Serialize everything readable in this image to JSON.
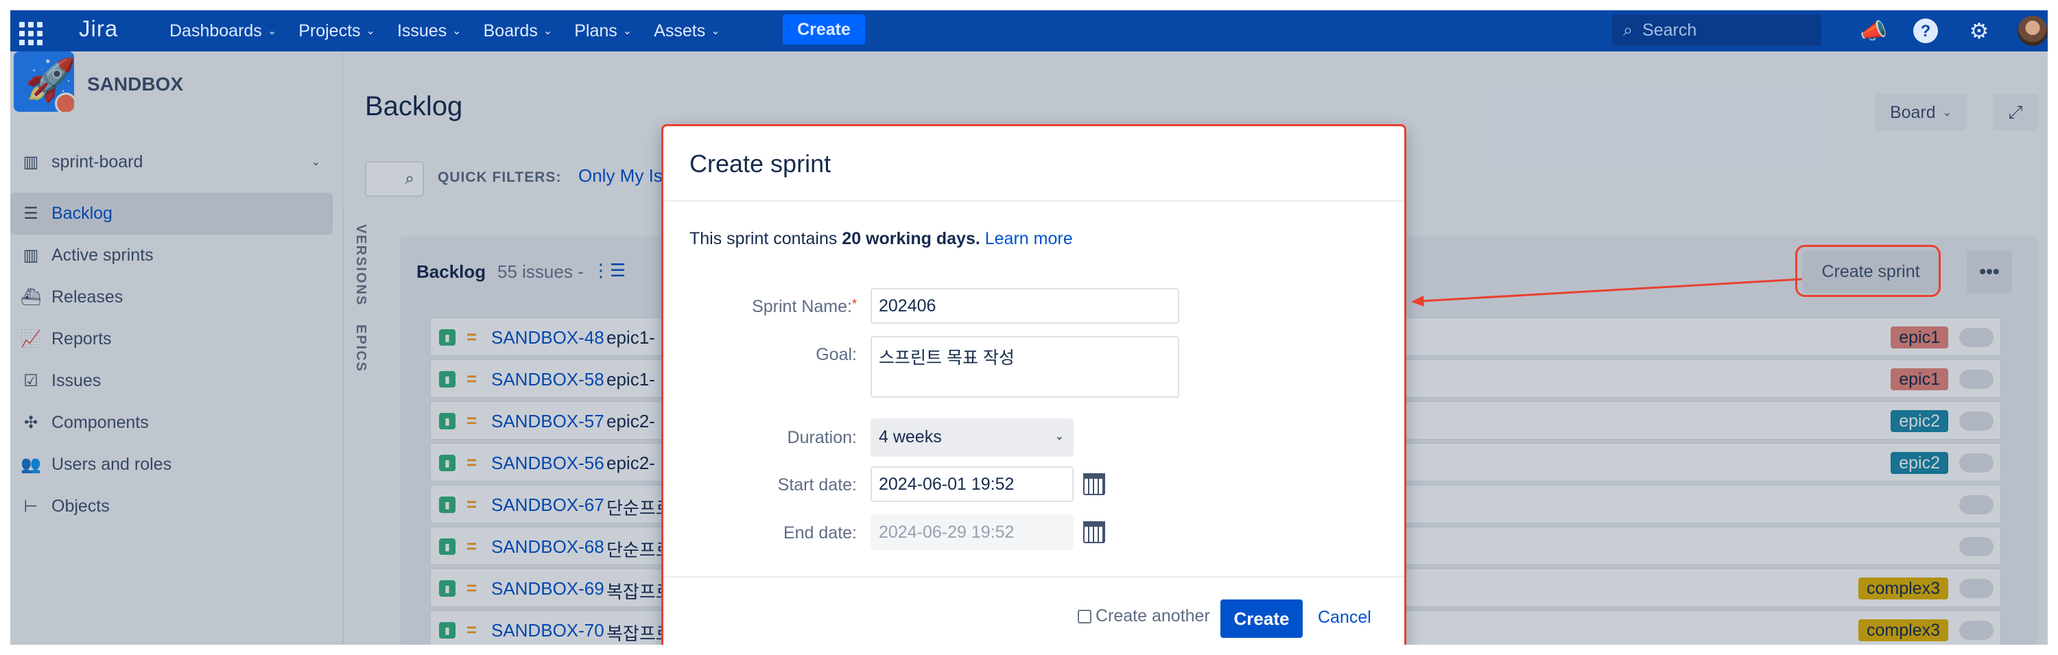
{
  "nav": {
    "logo": "Jira",
    "menus": [
      "Dashboards",
      "Projects",
      "Issues",
      "Boards",
      "Plans",
      "Assets"
    ],
    "create_label": "Create",
    "search_placeholder": "Search",
    "icons": [
      "app-switcher-icon",
      "notifications-icon",
      "help-icon",
      "settings-icon"
    ]
  },
  "sidebar": {
    "project_name": "SANDBOX",
    "board_selector": "sprint-board",
    "items": [
      {
        "label": "Backlog",
        "icon": "backlog-icon",
        "active": true
      },
      {
        "label": "Active sprints",
        "icon": "board-icon",
        "active": false
      },
      {
        "label": "Releases",
        "icon": "ship-icon",
        "active": false
      },
      {
        "label": "Reports",
        "icon": "chart-icon",
        "active": false
      },
      {
        "label": "Issues",
        "icon": "issues-icon",
        "active": false
      },
      {
        "label": "Components",
        "icon": "puzzle-icon",
        "active": false
      },
      {
        "label": "Users and roles",
        "icon": "users-icon",
        "active": false
      },
      {
        "label": "Objects",
        "icon": "hierarchy-icon",
        "active": false
      }
    ]
  },
  "main": {
    "title": "Backlog",
    "board_button": "Board",
    "quick_filters_label": "QUICK FILTERS:",
    "quick_filter_link": "Only My Is",
    "side_tabs": [
      "VERSIONS",
      "EPICS"
    ],
    "backlog": {
      "title": "Backlog",
      "count": "55 issues -",
      "create_sprint_label": "Create sprint",
      "more_label": "•••"
    },
    "issues": [
      {
        "key": "SANDBOX-48",
        "summary": "epic1-",
        "label": "epic1",
        "label_color": "#e8877a"
      },
      {
        "key": "SANDBOX-58",
        "summary": "epic1-",
        "label": "epic1",
        "label_color": "#e8877a"
      },
      {
        "key": "SANDBOX-57",
        "summary": "epic2-",
        "label": "epic2",
        "label_color": "#1d8aa8"
      },
      {
        "key": "SANDBOX-56",
        "summary": "epic2-",
        "label": "epic2",
        "label_color": "#1d8aa8"
      },
      {
        "key": "SANDBOX-67",
        "summary": "단순프로",
        "label": "",
        "label_color": ""
      },
      {
        "key": "SANDBOX-68",
        "summary": "단순프로",
        "label": "",
        "label_color": ""
      },
      {
        "key": "SANDBOX-69",
        "summary": "복잡프로",
        "label": "complex3",
        "label_color": "#e2b203"
      },
      {
        "key": "SANDBOX-70",
        "summary": "복잡프로",
        "label": "complex3",
        "label_color": "#e2b203"
      }
    ]
  },
  "modal": {
    "title": "Create sprint",
    "info_prefix": "This sprint contains",
    "info_bold": "20 working days.",
    "info_link": "Learn more",
    "name_label": "Sprint Name:",
    "required_mark": "*",
    "name_value": "202406",
    "goal_label": "Goal:",
    "goal_value": "스프린트 목표 작성",
    "duration_label": "Duration:",
    "duration_value": "4 weeks",
    "start_label": "Start date:",
    "start_value": "2024-06-01 19:52",
    "end_label": "End date:",
    "end_value": "2024-06-29 19:52",
    "create_another_label": "Create another",
    "create_label": "Create",
    "cancel_label": "Cancel"
  },
  "colors": {
    "nav_bg": "#0747a6",
    "primary": "#0052cc",
    "highlight": "#e8412f"
  }
}
